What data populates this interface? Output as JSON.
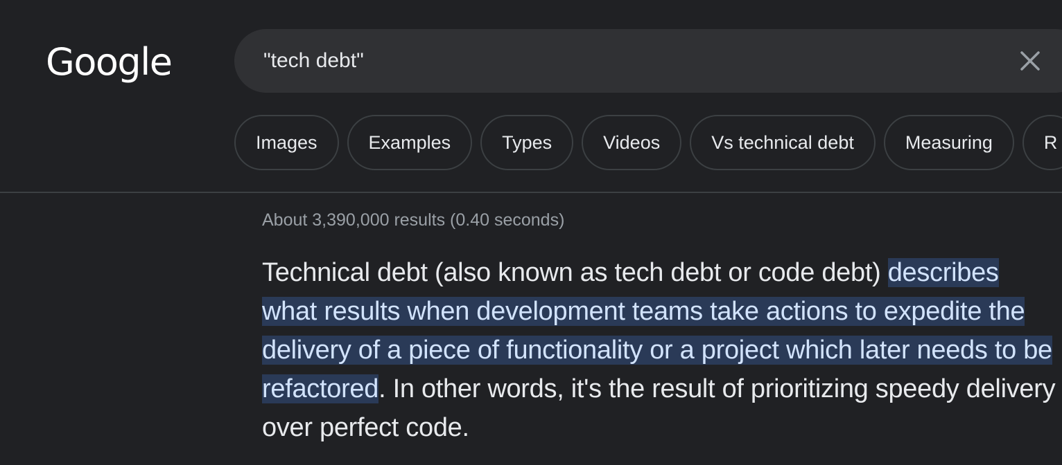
{
  "header": {
    "logo_text": "Google",
    "search": {
      "value": "\"tech debt\"",
      "clear_icon": "close-icon"
    }
  },
  "chips": [
    {
      "label": "Images"
    },
    {
      "label": "Examples"
    },
    {
      "label": "Types"
    },
    {
      "label": "Videos"
    },
    {
      "label": "Vs technical debt"
    },
    {
      "label": "Measuring"
    },
    {
      "label": "R"
    }
  ],
  "results": {
    "stats": "About 3,390,000 results (0.40 seconds)",
    "featured_snippet": {
      "prefix": "Technical debt (also known as tech debt or code debt) ",
      "highlighted": "describes what results when development teams take actions to expedite the delivery of a piece of functionality or a project which later needs to be refactored",
      "suffix": ". In other words, it's the result of prioritizing speedy delivery over perfect code."
    }
  },
  "colors": {
    "background": "#202124",
    "search_bg": "#303134",
    "highlight_bg": "#2a3a57",
    "muted_text": "#9aa0a6"
  }
}
